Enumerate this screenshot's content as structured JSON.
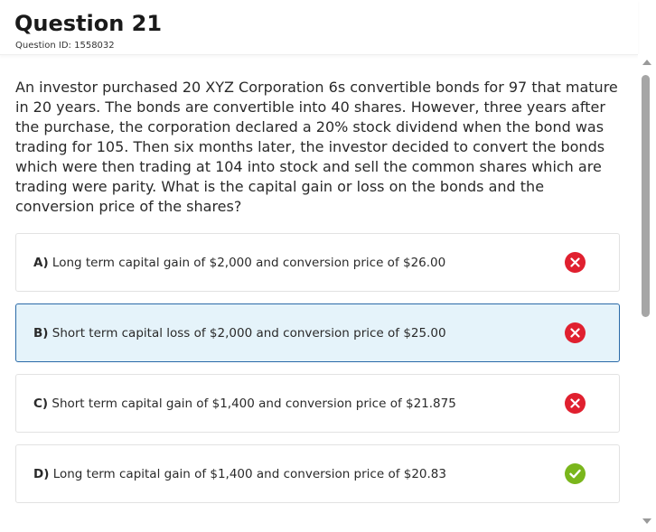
{
  "header": {
    "title": "Question 21",
    "question_id": "Question ID: 1558032"
  },
  "question": {
    "stem": "An investor purchased 20 XYZ Corporation 6s convertible bonds for 97 that mature in 20 years. The bonds are convertible into 40 shares. However, three years after the purchase, the corporation declared a 20% stock dividend when the bond was trading for 105. Then six months later, the investor decided to convert the bonds which were then trading at 104 into stock and sell the common shares which are trading were parity. What is the capital gain or loss on the bonds and the conversion price of the shares?"
  },
  "choices": [
    {
      "letter": "A)",
      "text": "Long term capital gain of $2,000 and conversion price of $26.00",
      "status": "incorrect",
      "selected": false,
      "icon": "x-circle-icon"
    },
    {
      "letter": "B)",
      "text": "Short term capital loss of $2,000 and conversion price of $25.00",
      "status": "incorrect",
      "selected": true,
      "icon": "x-circle-icon"
    },
    {
      "letter": "C)",
      "text": "Short term capital gain of $1,400 and conversion price of $21.875",
      "status": "incorrect",
      "selected": false,
      "icon": "x-circle-icon"
    },
    {
      "letter": "D)",
      "text": "Long term capital gain of $1,400 and conversion price of $20.83",
      "status": "correct",
      "selected": false,
      "icon": "check-circle-icon"
    }
  ],
  "colors": {
    "incorrect": "#e0202f",
    "correct": "#7ab61c",
    "selected_background": "#e5f3fa",
    "selected_border": "#2a6aa8"
  }
}
